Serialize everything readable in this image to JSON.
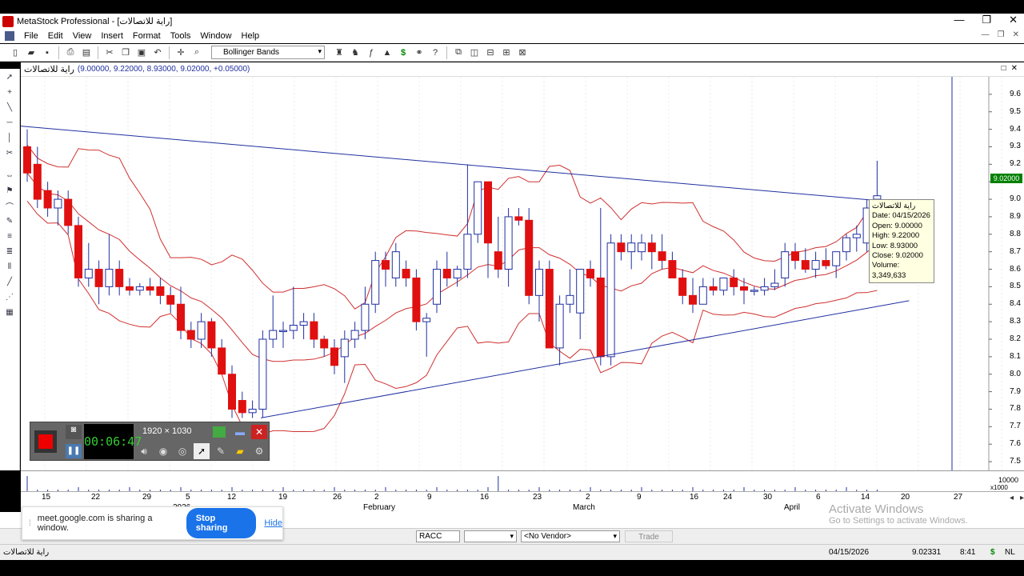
{
  "window": {
    "title": "MetaStock Professional - [راية للاتصالات]",
    "controls": [
      "—",
      "❐",
      "✕"
    ]
  },
  "menu": {
    "items": [
      "File",
      "Edit",
      "View",
      "Insert",
      "Format",
      "Tools",
      "Window",
      "Help"
    ],
    "mdi_controls": [
      "—",
      "❐",
      "✕"
    ]
  },
  "toolbar": {
    "indicator_select": "Bollinger Bands"
  },
  "chart_header": {
    "symbol": "راية للاتصالات",
    "ohlc": "(9.00000, 9.22000, 8.93000, 9.02000, +0.05000)"
  },
  "chart_data": {
    "type": "candlestick",
    "indicator": "Bollinger Bands",
    "ylim": [
      7.45,
      9.7
    ],
    "price_ticks": [
      9.6,
      9.5,
      9.4,
      9.3,
      9.2,
      9.1,
      9.0,
      8.9,
      8.8,
      8.7,
      8.6,
      8.5,
      8.4,
      8.3,
      8.2,
      8.1,
      8.0,
      7.9,
      7.8,
      7.7,
      7.6,
      7.5
    ],
    "last_price_flag": "9.02000",
    "candles": [
      [
        9.3,
        9.4,
        9.1,
        9.15
      ],
      [
        9.2,
        9.3,
        8.95,
        9.0
      ],
      [
        9.05,
        9.1,
        8.9,
        8.95
      ],
      [
        8.95,
        9.05,
        8.85,
        9.0
      ],
      [
        9.0,
        9.05,
        8.8,
        8.85
      ],
      [
        8.85,
        8.9,
        8.5,
        8.55
      ],
      [
        8.55,
        8.75,
        8.5,
        8.6
      ],
      [
        8.6,
        8.65,
        8.4,
        8.5
      ],
      [
        8.5,
        8.8,
        8.45,
        8.6
      ],
      [
        8.6,
        8.65,
        8.45,
        8.5
      ],
      [
        8.5,
        8.55,
        8.45,
        8.48
      ],
      [
        8.48,
        8.52,
        8.45,
        8.5
      ],
      [
        8.5,
        8.55,
        8.45,
        8.48
      ],
      [
        8.5,
        8.55,
        8.4,
        8.45
      ],
      [
        8.45,
        8.5,
        8.35,
        8.4
      ],
      [
        8.4,
        8.5,
        8.2,
        8.25
      ],
      [
        8.25,
        8.3,
        8.15,
        8.2
      ],
      [
        8.2,
        8.35,
        8.15,
        8.3
      ],
      [
        8.3,
        8.32,
        8.1,
        8.15
      ],
      [
        8.15,
        8.2,
        8.0,
        8.0
      ],
      [
        8.0,
        8.05,
        7.75,
        7.8
      ],
      [
        7.85,
        7.9,
        7.75,
        7.78
      ],
      [
        7.78,
        7.85,
        7.75,
        7.8
      ],
      [
        7.8,
        8.25,
        7.75,
        8.2
      ],
      [
        8.2,
        8.45,
        8.15,
        8.25
      ],
      [
        8.25,
        8.3,
        8.15,
        8.25
      ],
      [
        8.25,
        8.5,
        8.2,
        8.28
      ],
      [
        8.28,
        8.35,
        8.2,
        8.3
      ],
      [
        8.3,
        8.35,
        8.15,
        8.2
      ],
      [
        8.2,
        8.22,
        8.1,
        8.15
      ],
      [
        8.15,
        8.2,
        8.0,
        8.05
      ],
      [
        8.1,
        8.25,
        7.95,
        8.2
      ],
      [
        8.2,
        8.3,
        8.15,
        8.25
      ],
      [
        8.25,
        8.5,
        8.2,
        8.4
      ],
      [
        8.4,
        8.7,
        8.35,
        8.65
      ],
      [
        8.65,
        8.7,
        8.5,
        8.6
      ],
      [
        8.55,
        8.75,
        8.5,
        8.7
      ],
      [
        8.6,
        8.65,
        8.5,
        8.55
      ],
      [
        8.55,
        8.6,
        8.25,
        8.3
      ],
      [
        8.3,
        8.35,
        8.1,
        8.32
      ],
      [
        8.4,
        8.65,
        8.35,
        8.6
      ],
      [
        8.6,
        8.7,
        8.5,
        8.55
      ],
      [
        8.55,
        8.62,
        8.5,
        8.6
      ],
      [
        8.6,
        9.2,
        8.55,
        8.8
      ],
      [
        8.8,
        9.1,
        8.75,
        9.1
      ],
      [
        9.1,
        9.0,
        8.55,
        8.75
      ],
      [
        8.7,
        8.9,
        8.55,
        8.6
      ],
      [
        8.6,
        8.95,
        8.5,
        8.9
      ],
      [
        8.9,
        8.95,
        8.85,
        8.88
      ],
      [
        8.88,
        8.95,
        8.4,
        8.45
      ],
      [
        8.45,
        8.65,
        8.3,
        8.6
      ],
      [
        8.6,
        8.65,
        8.15,
        8.15
      ],
      [
        8.15,
        8.45,
        8.05,
        8.4
      ],
      [
        8.4,
        8.6,
        8.35,
        8.45
      ],
      [
        8.35,
        8.6,
        8.2,
        8.6
      ],
      [
        8.6,
        8.65,
        8.5,
        8.55
      ],
      [
        8.55,
        8.95,
        8.05,
        8.1
      ],
      [
        8.1,
        8.8,
        8.05,
        8.75
      ],
      [
        8.75,
        8.8,
        8.65,
        8.7
      ],
      [
        8.7,
        8.8,
        8.6,
        8.75
      ],
      [
        8.7,
        8.8,
        8.65,
        8.75
      ],
      [
        8.75,
        8.8,
        8.6,
        8.7
      ],
      [
        8.7,
        8.8,
        8.6,
        8.65
      ],
      [
        8.65,
        8.7,
        8.55,
        8.55
      ],
      [
        8.55,
        8.6,
        8.4,
        8.45
      ],
      [
        8.45,
        8.55,
        8.35,
        8.4
      ],
      [
        8.4,
        8.55,
        8.4,
        8.5
      ],
      [
        8.5,
        8.55,
        8.45,
        8.48
      ],
      [
        8.48,
        8.55,
        8.45,
        8.55
      ],
      [
        8.55,
        8.6,
        8.45,
        8.5
      ],
      [
        8.5,
        8.55,
        8.4,
        8.48
      ],
      [
        8.48,
        8.5,
        8.45,
        8.48
      ],
      [
        8.48,
        8.55,
        8.45,
        8.5
      ],
      [
        8.5,
        8.6,
        8.48,
        8.52
      ],
      [
        8.55,
        8.75,
        8.5,
        8.7
      ],
      [
        8.7,
        8.75,
        8.6,
        8.65
      ],
      [
        8.65,
        8.72,
        8.58,
        8.6
      ],
      [
        8.6,
        8.7,
        8.55,
        8.65
      ],
      [
        8.65,
        8.72,
        8.6,
        8.62
      ],
      [
        8.62,
        8.7,
        8.55,
        8.7
      ],
      [
        8.7,
        8.8,
        8.65,
        8.78
      ],
      [
        8.78,
        8.85,
        8.7,
        8.8
      ],
      [
        8.75,
        9.0,
        8.7,
        8.95
      ],
      [
        9.0,
        9.22,
        8.93,
        9.02
      ]
    ],
    "date_ticks": [
      "15",
      "22",
      "29",
      "5",
      "12",
      "19",
      "26",
      "2",
      "9",
      "16",
      "23",
      "2",
      "9",
      "16",
      "24",
      "30",
      "6",
      "14",
      "20",
      "27"
    ],
    "month_labels": [
      "2026",
      "February",
      "March",
      "April"
    ],
    "volume_scale_label": "10000",
    "volume_multiplier_label": "x1000"
  },
  "tooltip": {
    "symbol": "راية للاتصالات",
    "date": "Date: 04/15/2026",
    "open": "Open: 9.00000",
    "high": "High: 9.22000",
    "low": "Low: 8.93000",
    "close": "Close: 9.02000",
    "volume": "Volume: 3,349,633"
  },
  "recorder": {
    "timer": "00:06:47",
    "resolution": "1920 × 1030"
  },
  "share_bar": {
    "message": "meet.google.com is sharing a window.",
    "stop_label": "Stop sharing",
    "hide_label": "Hide"
  },
  "statusbar": {
    "symbol_field": "RACC",
    "vendor_select": "<No Vendor>",
    "trade_label": "Trade"
  },
  "bottom_status": {
    "symbol": "راية للاتصالات",
    "date": "04/15/2026",
    "price": "9.02331",
    "time": "8:41",
    "currency": "$",
    "lang": "NL"
  },
  "watermark": {
    "line1": "Activate Windows",
    "line2": "Go to Settings to activate Windows."
  }
}
